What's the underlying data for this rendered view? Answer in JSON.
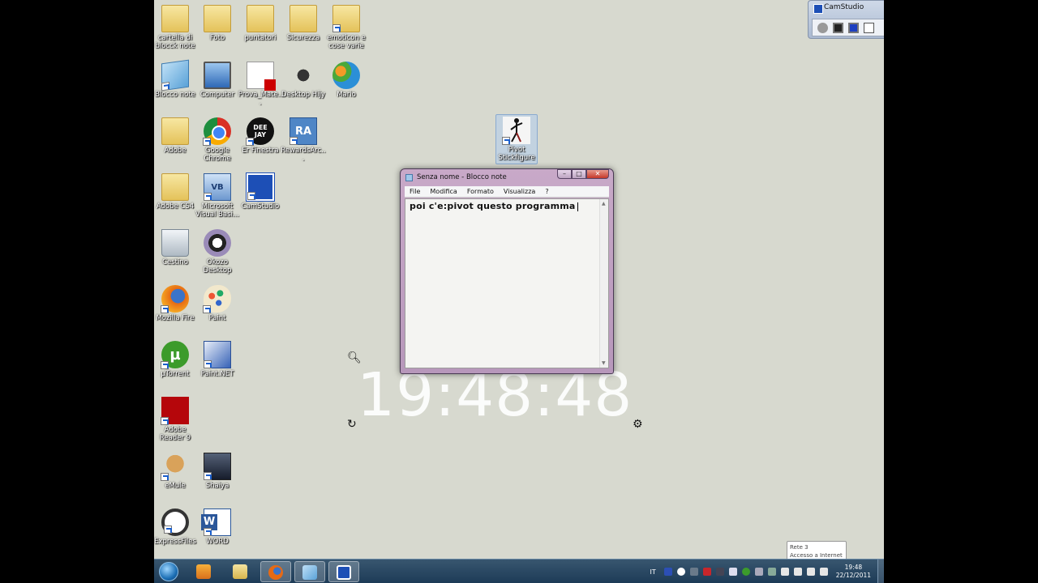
{
  "desktop": {
    "icons": [
      {
        "label": "cartella di blocck note"
      },
      {
        "label": "Foto"
      },
      {
        "label": "puntatori"
      },
      {
        "label": "Sicurezza"
      },
      {
        "label": "emoticon e cose varie"
      },
      {
        "label": "Blocco note"
      },
      {
        "label": "Computer"
      },
      {
        "label": "Prova_Mate..."
      },
      {
        "label": "Desktop Hijy"
      },
      {
        "label": "Mario"
      },
      {
        "label": "Adobe"
      },
      {
        "label": "Google Chrome"
      },
      {
        "label": "Er Finestra"
      },
      {
        "label": "RewardsArc..."
      },
      {
        "label": "Adobe CS4"
      },
      {
        "label": "Microsoft Visual Basi..."
      },
      {
        "label": "CamStudio"
      },
      {
        "label": "Cestino"
      },
      {
        "label": "Okozo Desktop"
      },
      {
        "label": "Mozilla Fire"
      },
      {
        "label": "Paint"
      },
      {
        "label": "µTorrent"
      },
      {
        "label": "Paint.NET"
      },
      {
        "label": "Adobe Reader 9"
      },
      {
        "label": "eMule"
      },
      {
        "label": "Shaiya"
      },
      {
        "label": "ExpressFiles"
      },
      {
        "label": "WORD"
      },
      {
        "label": "Pivot Stickfigure"
      }
    ]
  },
  "camstudio": {
    "title": "CamStudio"
  },
  "notepad": {
    "title": "Senza nome - Blocco note",
    "menu": [
      "File",
      "Modifica",
      "Formato",
      "Visualizza",
      "?"
    ],
    "content": "poi c'e:pivot questo programma"
  },
  "clock": {
    "time": "19:48:48"
  },
  "network_tooltip": {
    "line1": "Rete 3",
    "line2": "Accesso a Internet"
  },
  "taskbar": {
    "language": "IT",
    "time": "19:48",
    "date": "22/12/2011"
  }
}
